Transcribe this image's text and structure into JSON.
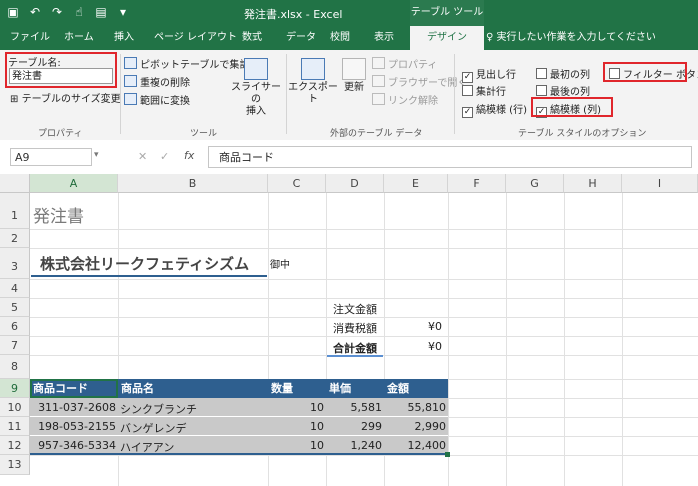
{
  "titlebar": {
    "title": "発注書.xlsx  -  Excel",
    "table_tools": "テーブル ツール"
  },
  "tabs": [
    "ファイル",
    "ホーム",
    "挿入",
    "ページ レイアウト",
    "数式",
    "データ",
    "校閲",
    "表示",
    "デザイン"
  ],
  "tell_me": "♀ 実行したい作業を入力してください",
  "ribbon": {
    "properties": {
      "table_name_label": "テーブル名:",
      "table_name_value": "発注書",
      "resize": "テーブルのサイズ変更",
      "group_label": "プロパティ"
    },
    "tools": {
      "pivot": "ピボットテーブルで集計",
      "remove_dup": "重複の削除",
      "convert_range": "範囲に変換",
      "slicer_line1": "スライサーの",
      "slicer_line2": "挿入",
      "group_label": "ツール"
    },
    "external": {
      "export": "エクスポート",
      "refresh": "更新",
      "properties": "プロパティ",
      "open_browser": "ブラウザーで開く",
      "unlink": "リンク解除",
      "group_label": "外部のテーブル データ"
    },
    "style_options": {
      "header_row": "見出し行",
      "total_row": "集計行",
      "banded_rows": "縞模様 (行)",
      "first_column": "最初の列",
      "last_column": "最後の列",
      "banded_columns": "縞模様 (列)",
      "filter_button": "フィルター ボタン",
      "group_label": "テーブル スタイルのオプション"
    }
  },
  "formula_bar": {
    "name_box": "A9",
    "fx": "fx",
    "content": "商品コード"
  },
  "columns": [
    "A",
    "B",
    "C",
    "D",
    "E",
    "F",
    "G",
    "H",
    "I"
  ],
  "rows": [
    "1",
    "2",
    "3",
    "4",
    "5",
    "6",
    "7",
    "8",
    "9",
    "10",
    "11",
    "12",
    "13"
  ],
  "sheet": {
    "doc_title": "発注書",
    "company": "株式会社リークフェティシズム",
    "honorific": "御中",
    "order_amount_label": "注文金額",
    "tax_label": "消費税額",
    "tax_value": "¥0",
    "total_label": "合計金額",
    "total_value": "¥0"
  },
  "table": {
    "headers": [
      "商品コード",
      "商品名",
      "数量",
      "単価",
      "金額"
    ],
    "rows": [
      [
        "311-037-2608",
        "シンクブランチ",
        "10",
        "5,581",
        "55,810"
      ],
      [
        "198-053-2155",
        "バンゲレンデ",
        "10",
        "299",
        "2,990"
      ],
      [
        "957-346-5334",
        "ハイアアン",
        "10",
        "1,240",
        "12,400"
      ]
    ]
  }
}
